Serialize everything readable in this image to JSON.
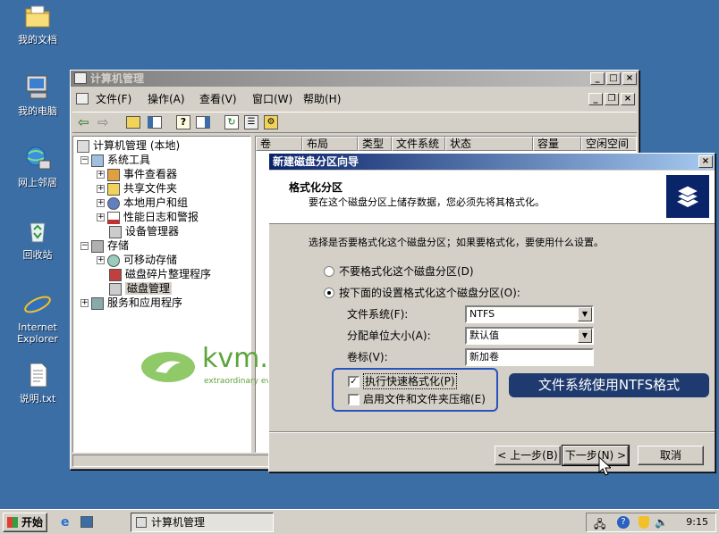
{
  "desktop": {
    "icons": [
      {
        "label": "我的文档",
        "icon": "folder-documents-icon"
      },
      {
        "label": "我的电脑",
        "icon": "computer-icon"
      },
      {
        "label": "网上邻居",
        "icon": "network-icon"
      },
      {
        "label": "回收站",
        "icon": "recycle-bin-icon"
      },
      {
        "label": "Internet Explorer",
        "icon": "ie-icon"
      },
      {
        "label": "说明.txt",
        "icon": "text-file-icon"
      }
    ]
  },
  "main_window": {
    "title": "计算机管理",
    "menu": [
      "文件(F)",
      "操作(A)",
      "查看(V)",
      "窗口(W)",
      "帮助(H)"
    ],
    "tree": [
      {
        "label": "计算机管理 (本地)",
        "level": 0,
        "expander": ""
      },
      {
        "label": "系统工具",
        "level": 1,
        "expander": "−"
      },
      {
        "label": "事件查看器",
        "level": 2,
        "expander": "+"
      },
      {
        "label": "共享文件夹",
        "level": 2,
        "expander": "+"
      },
      {
        "label": "本地用户和组",
        "level": 2,
        "expander": "+"
      },
      {
        "label": "性能日志和警报",
        "level": 2,
        "expander": "+"
      },
      {
        "label": "设备管理器",
        "level": 2,
        "expander": ""
      },
      {
        "label": "存储",
        "level": 1,
        "expander": "−"
      },
      {
        "label": "可移动存储",
        "level": 2,
        "expander": "+"
      },
      {
        "label": "磁盘碎片整理程序",
        "level": 2,
        "expander": ""
      },
      {
        "label": "磁盘管理",
        "level": 2,
        "expander": ""
      },
      {
        "label": "服务和应用程序",
        "level": 1,
        "expander": "+"
      }
    ],
    "columns": [
      "卷",
      "布局",
      "类型",
      "文件系统",
      "状态",
      "容量",
      "空闲空间"
    ]
  },
  "watermark": {
    "brand": "kvm.la",
    "tagline": "extraordinary every day"
  },
  "wizard": {
    "title": "新建磁盘分区向导",
    "header_title": "格式化分区",
    "header_subtitle": "要在这个磁盘分区上储存数据，您必须先将其格式化。",
    "question": "选择是否要格式化这个磁盘分区；如果要格式化，要使用什么设置。",
    "option_no_format": "不要格式化这个磁盘分区(D)",
    "option_format": "按下面的设置格式化这个磁盘分区(O):",
    "selected_option": "format",
    "fs_label": "文件系统(F):",
    "fs_value": "NTFS",
    "alloc_label": "分配单位大小(A):",
    "alloc_value": "默认值",
    "volume_label": "卷标(V):",
    "volume_value": "新加卷",
    "quick_format_label": "执行快速格式化(P)",
    "quick_format_checked": true,
    "compression_label": "启用文件和文件夹压缩(E)",
    "compression_checked": false,
    "back_label": "< 上一步(B)",
    "next_label": "下一步(N) >",
    "cancel_label": "取消",
    "annotation": "文件系统使用NTFS格式",
    "annotation_color": "#1e3a6e",
    "highlight_color": "#2a52be"
  },
  "taskbar": {
    "start_label": "开始",
    "task_label": "计算机管理",
    "clock": "9:15"
  }
}
